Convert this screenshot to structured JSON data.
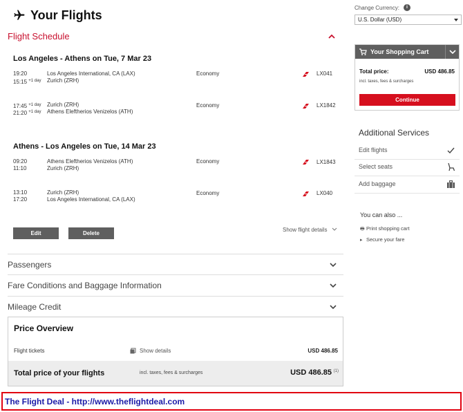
{
  "page": {
    "title": "Your Flights"
  },
  "schedule": {
    "section_title": "Flight Schedule",
    "outbound": {
      "title": "Los Angeles - Athens on Tue, 7 Mar 23",
      "segments": [
        {
          "dep_time": "19:20",
          "arr_time": "15:15",
          "arr_day": "+1 day",
          "dep_airport": "Los Angeles International, CA (LAX)",
          "arr_airport": "Zurich (ZRH)",
          "cabin": "Economy",
          "flight": "LX041"
        },
        {
          "dep_time": "17:45",
          "dep_day": "+1 day",
          "arr_time": "21:20",
          "arr_day": "+1 day",
          "dep_airport": "Zurich (ZRH)",
          "arr_airport": "Athens Eleftherios Venizelos (ATH)",
          "cabin": "Economy",
          "flight": "LX1842"
        }
      ]
    },
    "inbound": {
      "title": "Athens - Los Angeles on Tue, 14 Mar 23",
      "segments": [
        {
          "dep_time": "09:20",
          "arr_time": "11:10",
          "dep_airport": "Athens Eleftherios Venizelos (ATH)",
          "arr_airport": "Zurich (ZRH)",
          "cabin": "Economy",
          "flight": "LX1843"
        },
        {
          "dep_time": "13:10",
          "arr_time": "17:20",
          "dep_airport": "Zurich (ZRH)",
          "arr_airport": "Los Angeles International, CA (LAX)",
          "cabin": "Economy",
          "flight": "LX040"
        }
      ]
    },
    "edit_label": "Edit",
    "delete_label": "Delete",
    "show_details_label": "Show flight details"
  },
  "accordions": {
    "passengers": "Passengers",
    "fare": "Fare Conditions and Baggage Information",
    "mileage": "Mileage Credit"
  },
  "price_overview": {
    "title": "Price Overview",
    "tickets_label": "Flight tickets",
    "show_details": "Show details",
    "tickets_amount": "USD 486.85",
    "total_label": "Total price of your flights",
    "total_note": "incl. taxes, fees & surcharges",
    "total_amount": "USD 486.85",
    "footnote": "(1)"
  },
  "currency": {
    "label": "Change Currency:",
    "selected": "U.S. Dollar (USD)"
  },
  "cart": {
    "title": "Your Shopping Cart",
    "total_label": "Total price:",
    "total_amount": "USD 486.85",
    "note": "incl. taxes, fees & surcharges",
    "continue_label": "Continue"
  },
  "additional_services": {
    "title": "Additional Services",
    "items": [
      "Edit flights",
      "Select seats",
      "Add baggage"
    ]
  },
  "you_can_also": {
    "title": "You can also ...",
    "links": [
      "Print shopping cart",
      "Secure your fare"
    ]
  },
  "banner": {
    "text": "The Flight Deal - http://www.theflightdeal.com"
  },
  "colors": {
    "accent_red": "#c8102e",
    "button_red": "#d60f1e",
    "button_grey": "#5f5f5f",
    "banner_blue": "#1a1aa8"
  }
}
